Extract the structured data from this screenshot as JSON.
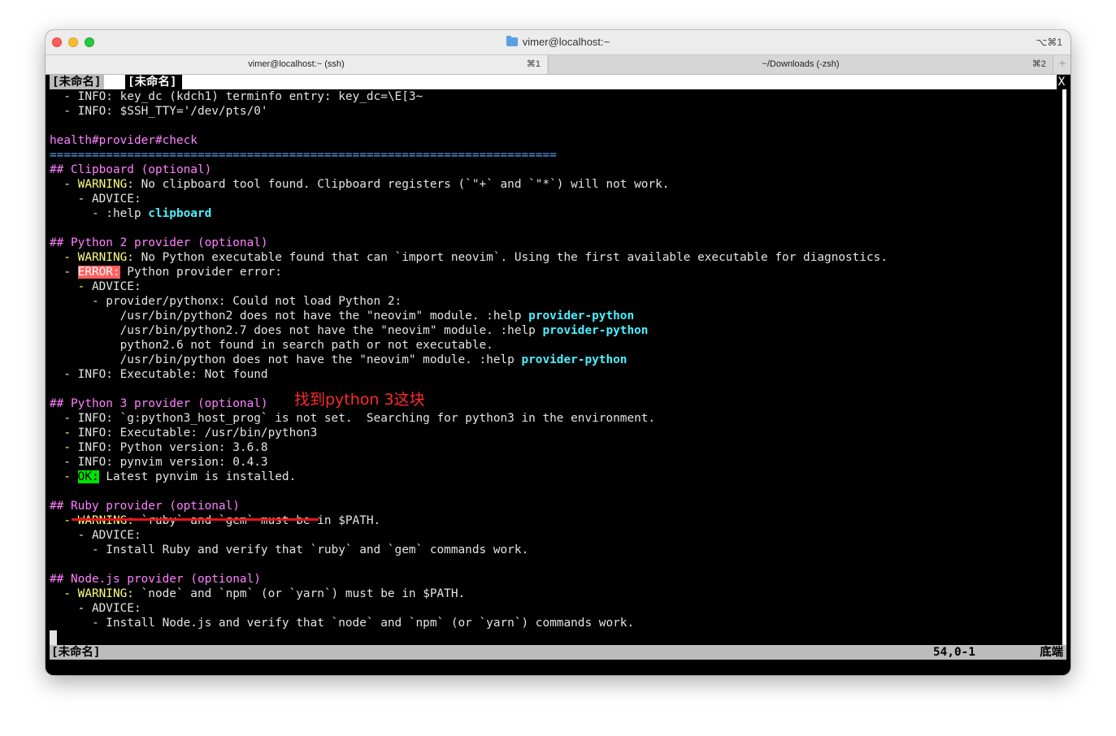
{
  "titlebar": {
    "title": "vimer@localhost:~",
    "shortcut": "⌥⌘1"
  },
  "tabs": [
    {
      "label": "vimer@localhost:~ (ssh)",
      "shortcut": "⌘1"
    },
    {
      "label": "~/Downloads (-zsh)",
      "shortcut": "⌘2"
    }
  ],
  "tab_add": "+",
  "vim": {
    "tabline": {
      "tab1": "[未命名]",
      "tab2": "[未命名]",
      "close": "X"
    },
    "lines": {
      "l0": "  - INFO: key_dc (kdch1) terminfo entry: key_dc=\\E[3~",
      "l1": "  - INFO: $SSH_TTY='/dev/pts/0'",
      "l3": "health#provider#check",
      "l4": "========================================================================",
      "l5": "## Clipboard (optional)",
      "l6_dash": "  - ",
      "l6_warn": "WARNING:",
      "l6_text": " No clipboard tool found. Clipboard registers (`\"+` and `\"*`) will not work.",
      "l7_dash": "    - ",
      "l7_adv": "ADVICE:",
      "l8_text": "      - :help ",
      "l8_link": "clipboard",
      "l10": "## Python 2 provider (optional)",
      "l11_dash": "  - ",
      "l11_warn": "WARNING:",
      "l11_text": " No Python executable found that can `import neovim`. Using the first available executable for diagnostics.",
      "l12_dash": "  - ",
      "l12_err": "ERROR:",
      "l12_text": " Python provider error:",
      "l13_dash": "    - ",
      "l13_adv": "ADVICE:",
      "l14": "      - provider/pythonx: Could not load Python 2:",
      "l15_text": "          /usr/bin/python2 does not have the \"neovim\" module. :help ",
      "l15_link": "provider-python",
      "l16_text": "          /usr/bin/python2.7 does not have the \"neovim\" module. :help ",
      "l16_link": "provider-python",
      "l17": "          python2.6 not found in search path or not executable.",
      "l18_text": "          /usr/bin/python does not have the \"neovim\" module. :help ",
      "l18_link": "provider-python",
      "l19_dash": "  - ",
      "l19_text": "INFO: Executable: Not found",
      "l21": "## Python 3 provider (optional)",
      "l22_dash": "  - ",
      "l22_text": "INFO: `g:python3_host_prog` is not set.  Searching for python3 in the environment.",
      "l23_dash": "  - ",
      "l23_text": "INFO: Executable: /usr/bin/python3",
      "l24_dash": "  - ",
      "l24_text": "INFO: Python version: 3.6.8",
      "l25_dash": "  - ",
      "l25_text": "INFO: pynvim version: 0.4.3",
      "l26_dash": "  - ",
      "l26_ok": "OK:",
      "l26_text": " Latest pynvim is installed.",
      "l28": "## Ruby provider (optional)",
      "l29_dash": "  - ",
      "l29_warn": "WARNING:",
      "l29_text": " `ruby` and `gem` must be in $PATH.",
      "l30_dash": "    - ",
      "l30_adv": "ADVICE:",
      "l31": "      - Install Ruby and verify that `ruby` and `gem` commands work.",
      "l33": "## Node.js provider (optional)",
      "l34_dash": "  - ",
      "l34_warn": "WARNING:",
      "l34_text": " `node` and `npm` (or `yarn`) must be in $PATH.",
      "l35_dash": "    - ",
      "l35_adv": "ADVICE:",
      "l36": "      - Install Node.js and verify that `node` and `npm` (or `yarn`) commands work."
    },
    "statusline": {
      "name": "[未命名]",
      "position": "54,0-1",
      "scroll": "底端"
    }
  },
  "annotation": {
    "text": "找到python 3这块",
    "color": "#ff2a2a"
  },
  "colors": {
    "heading": "#ff80ff",
    "warning": "#ffff80",
    "link": "#4cf0ff",
    "error_bg": "#ff5f5f",
    "ok_bg": "#00e000",
    "rule": "#5fa8ff"
  }
}
